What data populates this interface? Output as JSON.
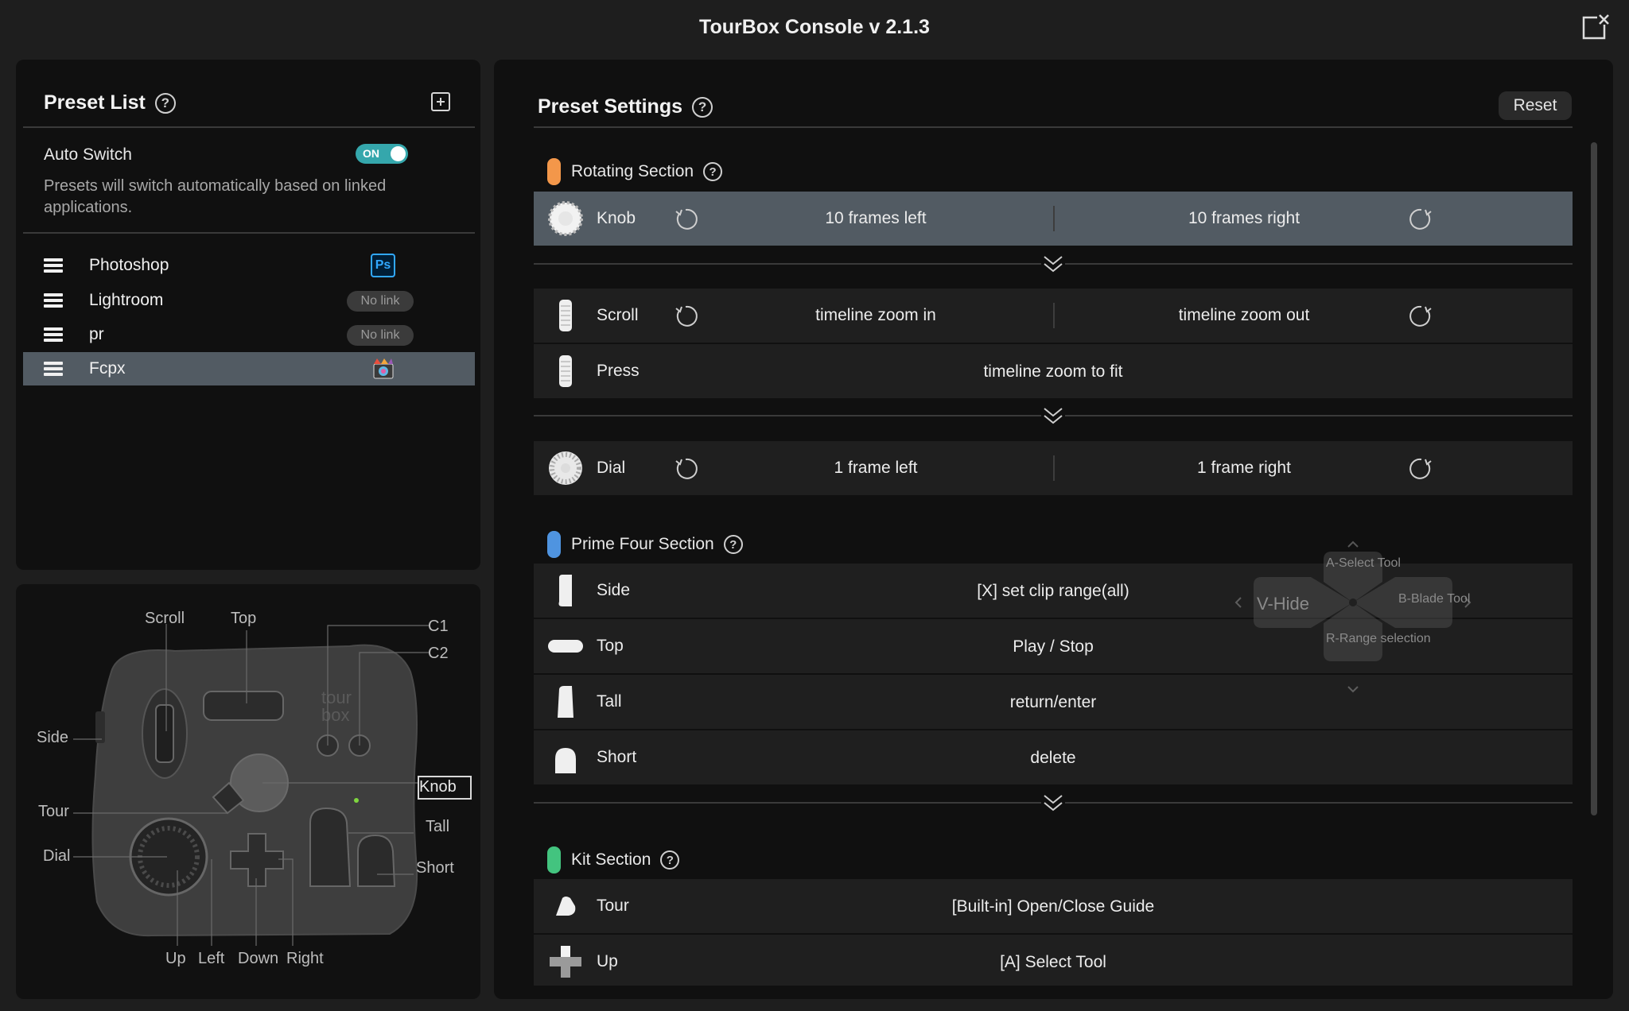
{
  "app": {
    "title": "TourBox Console v 2.1.3"
  },
  "preset_list": {
    "title": "Preset List",
    "auto_switch": {
      "label": "Auto Switch",
      "state": "ON",
      "description": "Presets will switch automatically based on linked applications."
    },
    "items": [
      {
        "name": "Photoshop",
        "link": "Ps"
      },
      {
        "name": "Lightroom",
        "link": "No link"
      },
      {
        "name": "pr",
        "link": "No link"
      },
      {
        "name": "Fcpx",
        "link": "fcpx-icon"
      }
    ],
    "selected": "Fcpx"
  },
  "device": {
    "labels": {
      "scroll": "Scroll",
      "top": "Top",
      "c1": "C1",
      "c2": "C2",
      "side": "Side",
      "knob": "Knob",
      "tour": "Tour",
      "tall": "Tall",
      "dial": "Dial",
      "short": "Short",
      "up": "Up",
      "left": "Left",
      "down": "Down",
      "right": "Right"
    },
    "brand": "tour box"
  },
  "settings": {
    "title": "Preset Settings",
    "reset_label": "Reset",
    "rotating": {
      "title": "Rotating Section",
      "color": "#f3974a",
      "knob": {
        "name": "Knob",
        "left": "10 frames left",
        "right": "10 frames right"
      },
      "scroll": {
        "name": "Scroll",
        "left": "timeline zoom in",
        "right": "timeline zoom out"
      },
      "press": {
        "name": "Press",
        "action": "timeline zoom to fit"
      },
      "dial": {
        "name": "Dial",
        "left": "1 frame left",
        "right": "1 frame right"
      }
    },
    "prime": {
      "title": "Prime Four Section",
      "color": "#4f94e0",
      "rows": [
        {
          "name": "Side",
          "action": "[X] set clip range(all)"
        },
        {
          "name": "Top",
          "action": "Play / Stop"
        },
        {
          "name": "Tall",
          "action": "return/enter"
        },
        {
          "name": "Short",
          "action": "delete"
        }
      ]
    },
    "kit": {
      "title": "Kit Section",
      "color": "#43c47f",
      "rows": [
        {
          "name": "Tour",
          "action": "[Built-in] Open/Close Guide"
        },
        {
          "name": "Up",
          "action": "[A] Select Tool"
        }
      ]
    },
    "hud": {
      "up": "A-Select Tool",
      "left": "V-Hide",
      "right": "B-Blade Tool",
      "down": "R-Range selection"
    }
  }
}
